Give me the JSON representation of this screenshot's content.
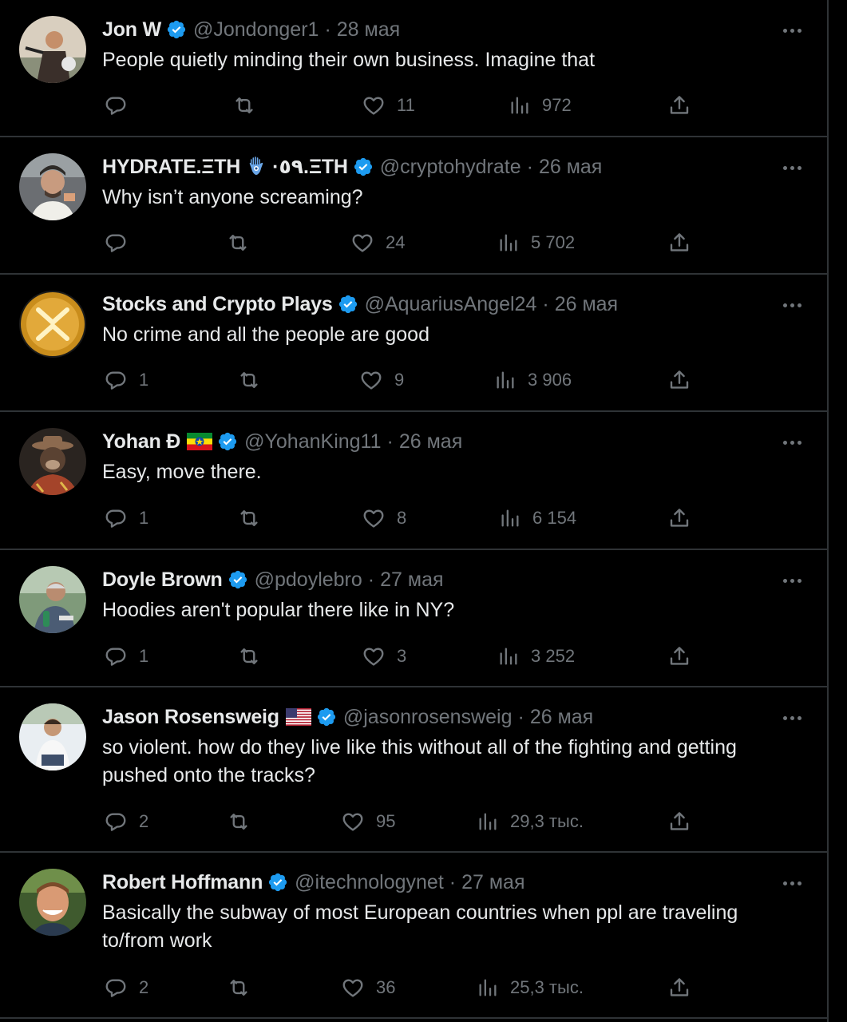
{
  "tweets": [
    {
      "name": "Jon W",
      "handle": "@Jondonger1",
      "date": "28 мая",
      "text": "People quietly minding their own business. Imagine that",
      "replies": "",
      "retweets": "",
      "likes": "11",
      "views": "972"
    },
    {
      "name": "HYDRATE.ΞTH",
      "name_suffix": "·٥٩.ΞTH",
      "handle": "@cryptohydrate",
      "date": "26 мая",
      "text": "Why isn’t anyone screaming?",
      "replies": "",
      "retweets": "",
      "likes": "24",
      "views": "5 702"
    },
    {
      "name": "Stocks and Crypto Plays",
      "handle": "@AquariusAngel24",
      "date": "26 мая",
      "text": "No crime and all the people are good",
      "replies": "1",
      "retweets": "",
      "likes": "9",
      "views": "3 906"
    },
    {
      "name": "Yohan Đ",
      "handle": "@YohanKing11",
      "date": "26 мая",
      "text": "Easy, move there.",
      "replies": "1",
      "retweets": "",
      "likes": "8",
      "views": "6 154"
    },
    {
      "name": "Doyle Brown",
      "handle": "@pdoylebro",
      "date": "27 мая",
      "text": "Hoodies aren't popular there like in NY?",
      "replies": "1",
      "retweets": "",
      "likes": "3",
      "views": "3 252"
    },
    {
      "name": "Jason Rosensweig",
      "handle": "@jasonrosensweig",
      "date": "26 мая",
      "text": "so violent. how do they live like this without all of the fighting and getting pushed onto the tracks?",
      "replies": "2",
      "retweets": "",
      "likes": "95",
      "views": "29,3 тыс."
    },
    {
      "name": "Robert Hoffmann",
      "handle": "@itechnologynet",
      "date": "27 мая",
      "text": "Basically the subway of most European countries when ppl are traveling to/from work",
      "replies": "2",
      "retweets": "",
      "likes": "36",
      "views": "25,3 тыс."
    }
  ],
  "colors": {
    "background": "#000000",
    "text_primary": "#e7e9ea",
    "text_secondary": "#71767b",
    "verified_blue": "#1d9bf0",
    "divider": "#2f3336"
  },
  "icons": [
    "reply-icon",
    "retweet-icon",
    "like-icon",
    "views-icon",
    "share-icon",
    "verified-badge-icon",
    "more-icon"
  ]
}
